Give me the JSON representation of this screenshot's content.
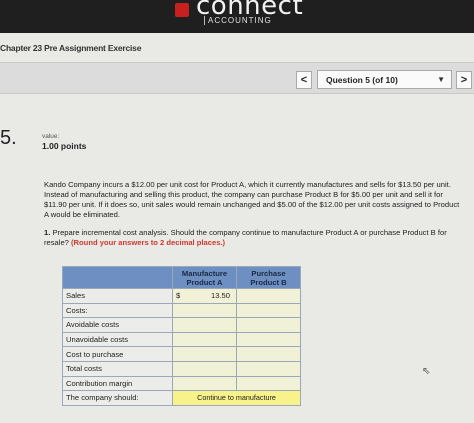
{
  "header": {
    "logo_text": "connect",
    "logo_sub": "ACCOUNTING"
  },
  "chapter_title": "Chapter 23 Pre Assignment Exercise",
  "nav": {
    "prev": "<",
    "question_select": "Question 5 (of 10)",
    "next": ">"
  },
  "question": {
    "number": "5.",
    "value_label": "value:",
    "points": "1.00 points",
    "problem_text": "Kando Company incurs a $12.00 per unit cost for Product A, which it currently manufactures and sells for $13.50 per unit. Instead of manufacturing and selling this product, the company can purchase Product B for $5.00 per unit and sell it for $11.90 per unit. If it does so, unit sales would remain unchanged and $5.00 of the $12.00 per unit costs assigned to Product A would be eliminated.",
    "req_number": "1.",
    "req_text": "Prepare incremental cost analysis. Should the company continue to manufacture Product A or purchase Product B for resale?",
    "req_hint": "(Round your answers to 2 decimal places.)"
  },
  "table": {
    "col1_header": "Manufacture Product A",
    "col2_header": "Purchase Product B",
    "rows": {
      "sales": "Sales",
      "costs": "Costs:",
      "avoidable": "Avoidable costs",
      "unavoidable": "Unavoidable costs",
      "cost_to_purchase": "Cost to purchase",
      "total_costs": "Total costs",
      "contribution_margin": "Contribution margin",
      "company_should": "The company should:"
    },
    "sales_currency": "$",
    "sales_product_a": "13.50",
    "decision_value": "Continue to manufacture"
  }
}
